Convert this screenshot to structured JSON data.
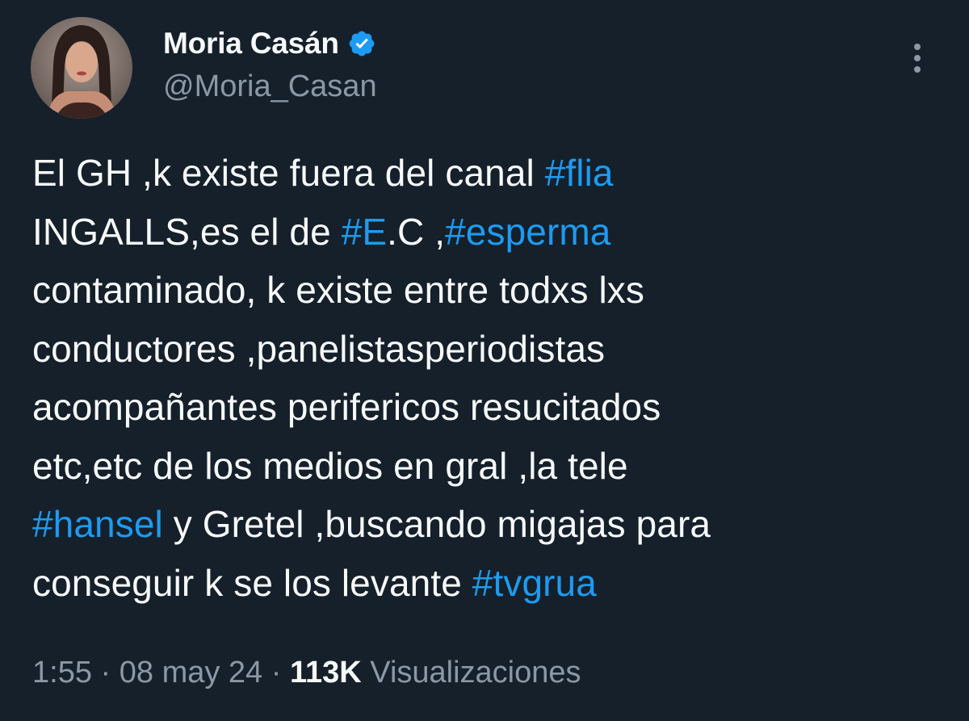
{
  "author": {
    "display_name": "Moria Casán",
    "handle": "@Moria_Casan",
    "verified_icon": "verified-badge-icon"
  },
  "tweet": {
    "lines": [
      [
        {
          "t": "El GH ,k existe fuera del canal "
        },
        {
          "t": "#flia",
          "tag": true
        }
      ],
      [
        {
          "t": "INGALLS,es el de "
        },
        {
          "t": "#E",
          "tag": true
        },
        {
          "t": ".C ,"
        },
        {
          "t": "#esperma",
          "tag": true
        }
      ],
      [
        {
          "t": "contaminado, k existe entre todxs lxs"
        }
      ],
      [
        {
          "t": "conductores ,panelistasperiodistas"
        }
      ],
      [
        {
          "t": "acompañantes perifericos resucitados"
        }
      ],
      [
        {
          "t": "etc,etc de los medios en gral ,la tele"
        }
      ],
      [
        {
          "t": "#hansel",
          "tag": true
        },
        {
          "t": " y Gretel ,buscando migajas para"
        }
      ],
      [
        {
          "t": "conseguir k se los levante "
        },
        {
          "t": "#tvgrua",
          "tag": true
        }
      ]
    ]
  },
  "meta": {
    "time": "1:55",
    "separator": "·",
    "date": "08 may 24",
    "views_count": "113K",
    "views_label": "Visualizaciones"
  },
  "colors": {
    "background": "#15202b",
    "text": "#f7f9f9",
    "secondary": "#8b98a5",
    "link": "#1d9bf0"
  }
}
